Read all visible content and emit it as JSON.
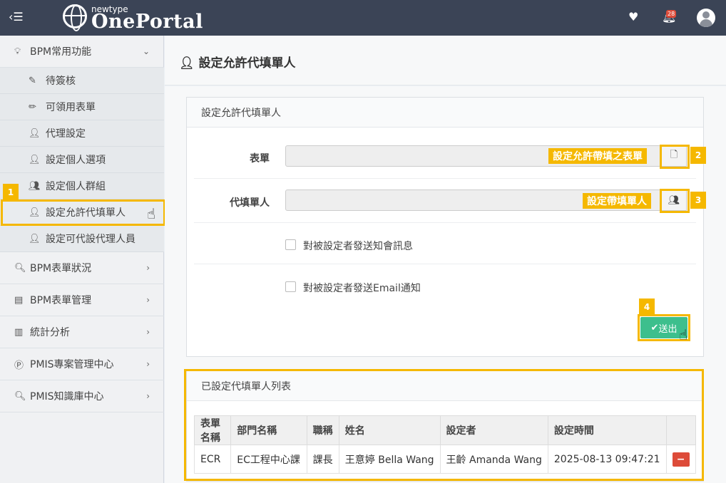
{
  "topbar": {
    "hamburger_icon": "☰",
    "logo_small": "newtype",
    "logo_big": "OnePortal",
    "notification_count": "28"
  },
  "sidebar": {
    "group": {
      "label": "BPM常用功能",
      "icon": "lightbulb-icon"
    },
    "sub_items": [
      {
        "label": "待簽核",
        "icon": "edit-icon"
      },
      {
        "label": "可領用表單",
        "icon": "pencil-icon"
      },
      {
        "label": "代理設定",
        "icon": "user-plus-icon"
      },
      {
        "label": "設定個人選項",
        "icon": "user-icon"
      },
      {
        "label": "設定個人群組",
        "icon": "users-icon"
      },
      {
        "label": "設定允許代填單人",
        "icon": "user-icon"
      },
      {
        "label": "設定可代設代理人員",
        "icon": "user-icon"
      }
    ],
    "items": [
      {
        "label": "BPM表單狀況",
        "icon": "search-icon"
      },
      {
        "label": "BPM表單管理",
        "icon": "server-icon"
      },
      {
        "label": "統計分析",
        "icon": "bar-chart-icon"
      },
      {
        "label": "PMIS專案管理中心",
        "icon": "p-circle-icon"
      },
      {
        "label": "PMIS知識庫中心",
        "icon": "search-icon"
      }
    ]
  },
  "page": {
    "title": "設定允許代填單人"
  },
  "form_box": {
    "title": "設定允許代填單人",
    "form_label": "表單",
    "filler_label": "代填單人",
    "notify_label": "對被設定者發送知會訊息",
    "email_label": "對被設定者發送Email通知",
    "submit_label": "送出"
  },
  "callouts": {
    "n1": "1",
    "n2": "2",
    "n3": "3",
    "n4": "4",
    "tip2": "設定允許帶填之表單",
    "tip3": "設定帶填單人"
  },
  "list_box": {
    "title": "已設定代填單人列表",
    "columns": [
      "表單名稱",
      "部門名稱",
      "職稱",
      "姓名",
      "設定者",
      "設定時間",
      ""
    ],
    "rows": [
      [
        "ECR",
        "EC工程中心課",
        "課長",
        "王意婷 Bella Wang",
        "王齡 Amanda Wang",
        "2025-08-13 09:47:21"
      ]
    ]
  },
  "colors": {
    "accent": "#f5b800",
    "submit": "#3dbf8d",
    "delete": "#dd4b39",
    "navbar": "#3b4456"
  }
}
